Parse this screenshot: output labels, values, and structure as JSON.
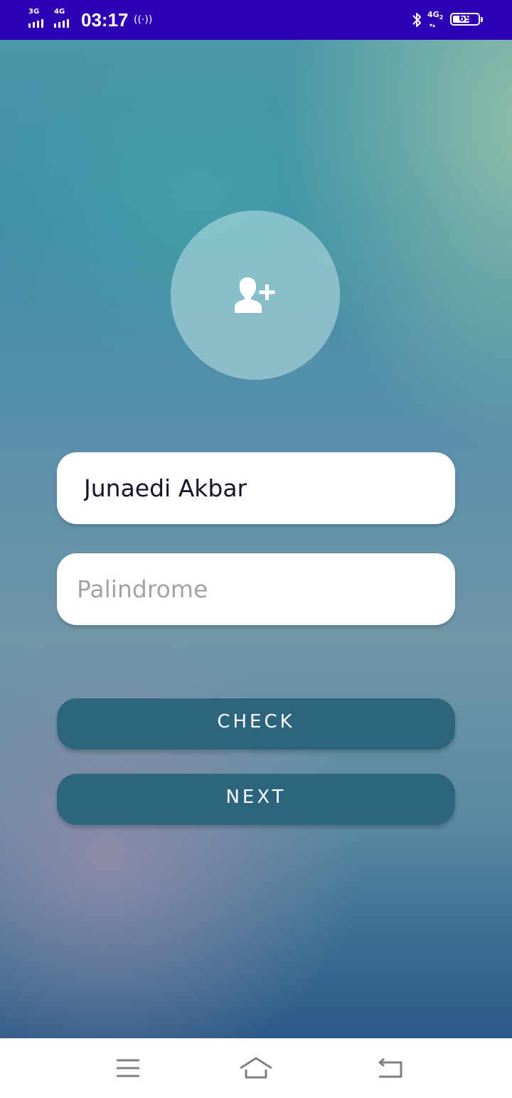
{
  "status_bar": {
    "network_1": "3G",
    "network_2": "4G",
    "time": "03:17",
    "hotspot_icon": "hotspot-icon",
    "bluetooth_icon": "bluetooth-icon",
    "data_network": "4G",
    "data_network_sub": "2",
    "battery_level": "69",
    "battery_fraction": 0.69,
    "background_color": "#2e00b4"
  },
  "profile": {
    "avatar_icon": "add-user-icon"
  },
  "form": {
    "name_value": "Junaedi Akbar",
    "palindrome_value": "",
    "palindrome_placeholder": "Palindrome"
  },
  "buttons": {
    "check_label": "CHECK",
    "next_label": "NEXT",
    "button_color": "#2c657d"
  },
  "nav_bar": {
    "menu_icon": "menu-icon",
    "home_icon": "home-icon",
    "back_icon": "back-icon"
  }
}
